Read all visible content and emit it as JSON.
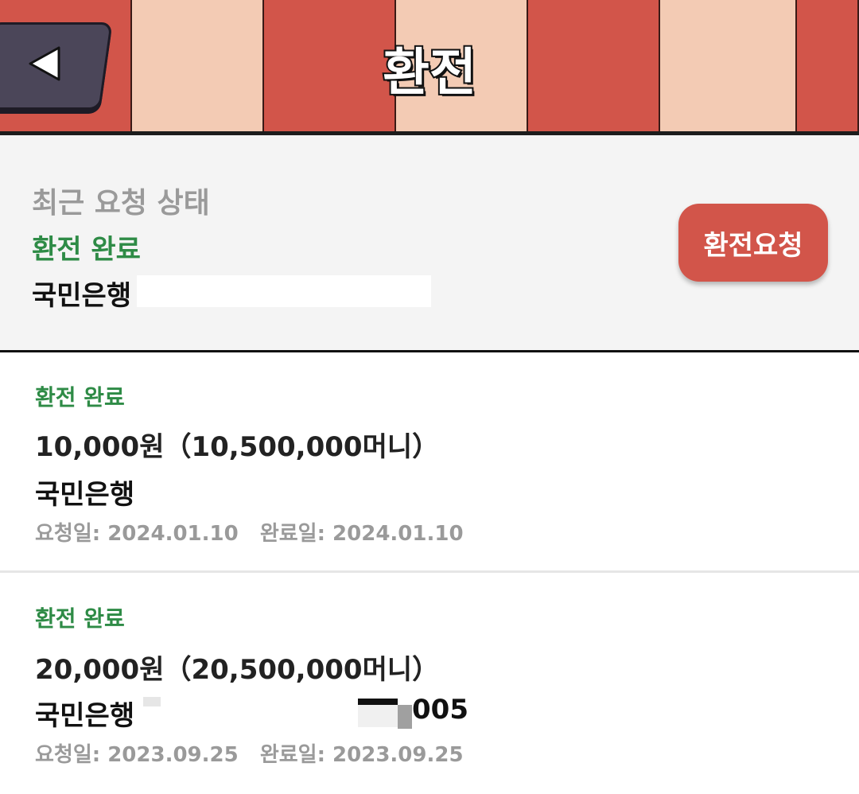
{
  "header": {
    "title": "환전",
    "back_icon": "back-arrow-icon",
    "colors": {
      "stripe_red": "#d2554a",
      "stripe_pink": "#f3cbb4",
      "back_button": "#4b4659"
    }
  },
  "status_panel": {
    "heading": "최근 요청 상태",
    "status": "환전 완료",
    "bank": "국민은행",
    "request_button": "환전요청"
  },
  "records": [
    {
      "status": "환전 완료",
      "amount": "10,000원（10,500,000머니）",
      "bank": "국민은행",
      "dates": "요청일: 2024.01.10   완료일: 2024.01.10"
    },
    {
      "status": "환전 완료",
      "amount": "20,000원（20,500,000머니）",
      "bank": "국민은행",
      "account_suffix": "005",
      "dates": "요청일: 2023.09.25   완료일: 2023.09.25"
    }
  ],
  "colors": {
    "accent": "#d2554a",
    "status_green": "#2e8b46"
  }
}
